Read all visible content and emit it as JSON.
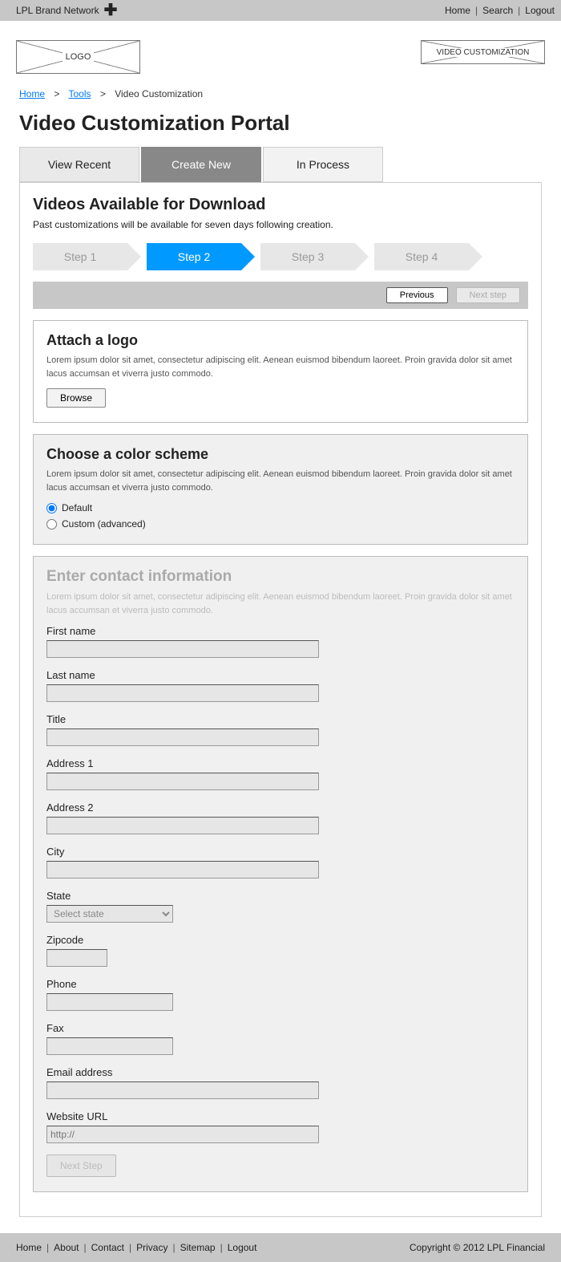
{
  "topbar": {
    "brand": "LPL Brand Network",
    "links": [
      "Home",
      "Search",
      "Logout"
    ]
  },
  "header": {
    "logo_left": "LOGO",
    "logo_right": "VIDEO CUSTOMIZATION"
  },
  "breadcrumb": {
    "home": "Home",
    "tools": "Tools",
    "current": "Video Customization"
  },
  "page_title": "Video Customization Portal",
  "tabs": {
    "view_recent": "View Recent",
    "create_new": "Create New",
    "in_process": "In Process"
  },
  "downloads": {
    "title": "Videos Available for Download",
    "note": "Past customizations will be available for seven days following creation."
  },
  "steps": [
    "Step 1",
    "Step 2",
    "Step 3",
    "Step 4"
  ],
  "nav_buttons": {
    "previous": "Previous",
    "next": "Next step"
  },
  "attach": {
    "title": "Attach a logo",
    "desc": "Lorem ipsum dolor sit amet, consectetur adipiscing elit. Aenean euismod bibendum laoreet. Proin gravida dolor sit amet lacus accumsan et viverra justo commodo.",
    "browse": "Browse"
  },
  "color": {
    "title": "Choose a color scheme",
    "desc": "Lorem ipsum dolor sit amet, consectetur adipiscing elit. Aenean euismod bibendum laoreet. Proin gravida dolor sit amet lacus accumsan et viverra justo commodo.",
    "opt_default": "Default",
    "opt_custom": "Custom (advanced)"
  },
  "contact": {
    "title": "Enter contact information",
    "desc": "Lorem ipsum dolor sit amet, consectetur adipiscing elit. Aenean euismod bibendum laoreet. Proin gravida dolor sit amet lacus accumsan et viverra justo commodo.",
    "first_name": "First name",
    "last_name": "Last name",
    "ftitle": "Title",
    "address1": "Address 1",
    "address2": "Address 2",
    "city": "City",
    "state": "State",
    "state_placeholder": "Select state",
    "zipcode": "Zipcode",
    "phone": "Phone",
    "fax": "Fax",
    "email": "Email address",
    "website": "Website URL",
    "website_placeholder": "http://",
    "next_step": "Next Step"
  },
  "footer": {
    "links": [
      "Home",
      "About",
      "Contact",
      "Privacy",
      "Sitemap",
      "Logout"
    ],
    "copyright": "Copyright © 2012 LPL Financial"
  }
}
